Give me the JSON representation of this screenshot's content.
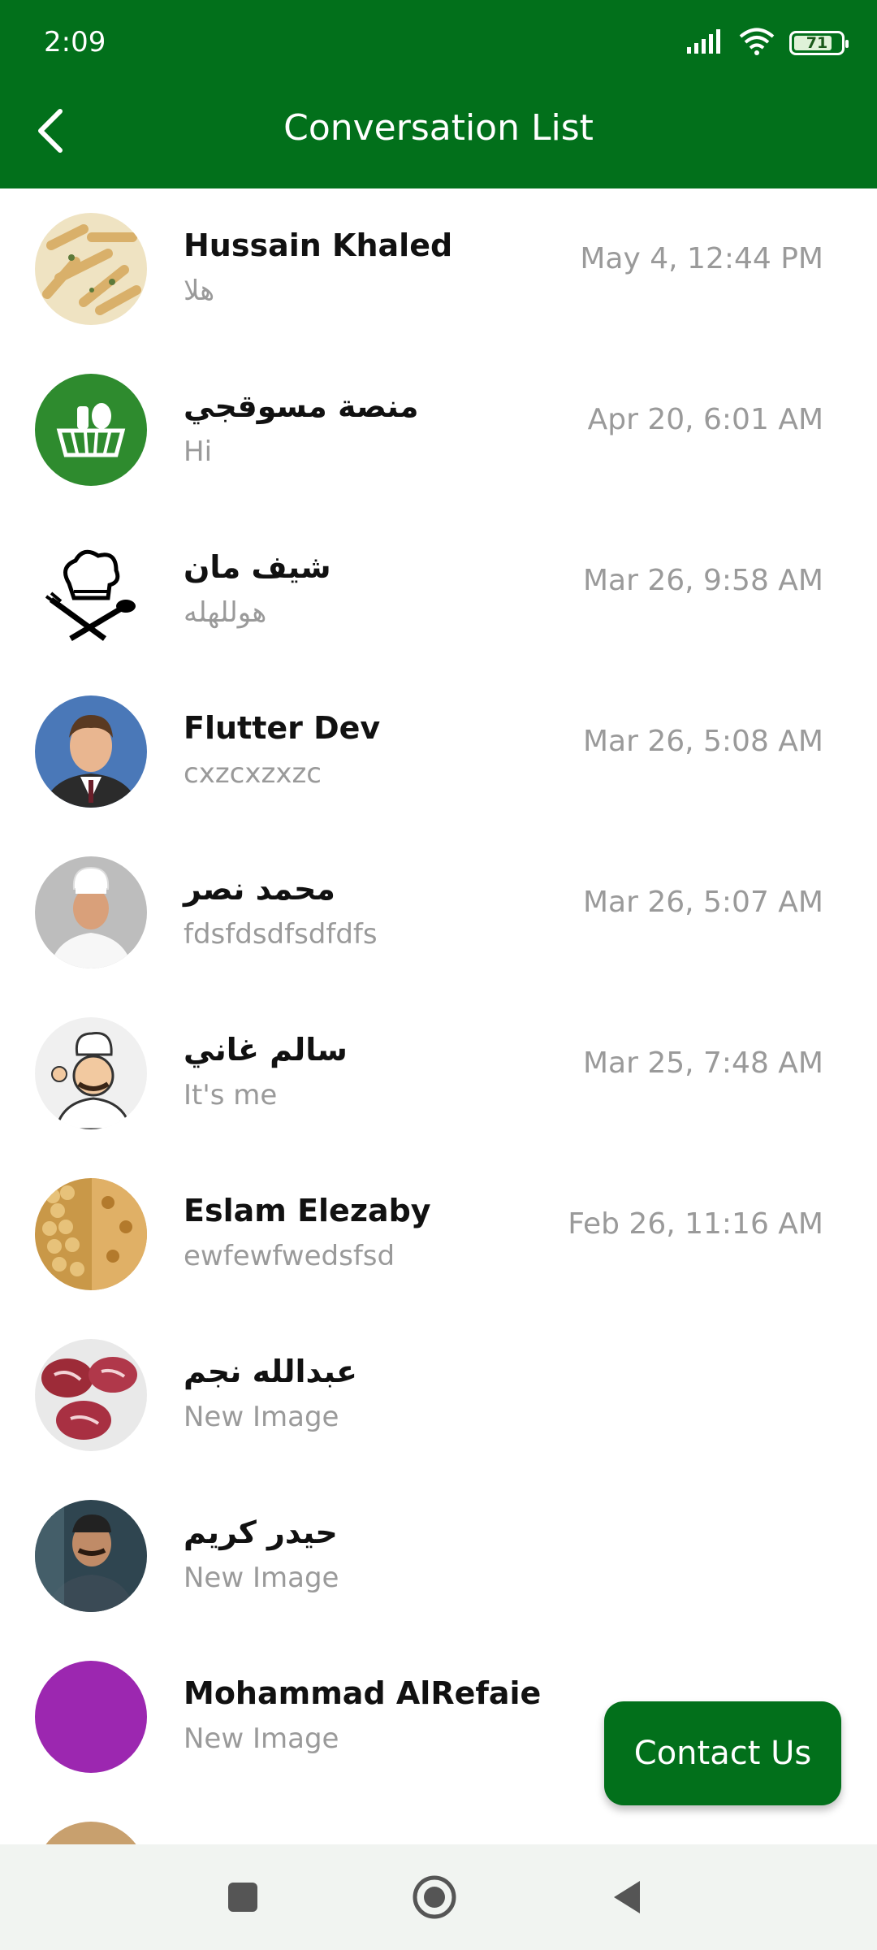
{
  "status_bar": {
    "time": "2:09",
    "battery": "71",
    "icons": [
      "signal-icon",
      "wifi-icon",
      "battery-icon"
    ]
  },
  "app_bar": {
    "title": "Conversation List",
    "back_icon": "back-arrow-icon",
    "color": "#02701b"
  },
  "conversations": [
    {
      "name": "Hussain Khaled",
      "last_message": "هلا",
      "time": "May 4, 12:44 PM"
    },
    {
      "name": "منصة مسوقجي",
      "last_message": "Hi",
      "time": "Apr 20, 6:01 AM"
    },
    {
      "name": "شيف مان",
      "last_message": "هوللهله",
      "time": "Mar 26, 9:58 AM"
    },
    {
      "name": "Flutter Dev",
      "last_message": "cxzcxzxzc",
      "time": "Mar 26, 5:08 AM"
    },
    {
      "name": "محمد نصر",
      "last_message": "fdsfdsdfsdfdfs",
      "time": "Mar 26, 5:07 AM"
    },
    {
      "name": "سالم غاني",
      "last_message": "It's me",
      "time": "Mar 25, 7:48 AM"
    },
    {
      "name": "Eslam Elezaby",
      "last_message": "ewfewfwedsfsd",
      "time": "Feb 26, 11:16 AM"
    },
    {
      "name": "عبدالله نجم",
      "last_message": "New Image",
      "time": ""
    },
    {
      "name": "حيدر كريم",
      "last_message": "New Image",
      "time": ""
    },
    {
      "name": "Mohammad AlRefaie",
      "last_message": "New Image",
      "time": ""
    }
  ],
  "fab": {
    "label": "Contact Us"
  },
  "nav_bar": {
    "icons": [
      "recents-square-icon",
      "home-circle-icon",
      "back-triangle-icon"
    ]
  }
}
